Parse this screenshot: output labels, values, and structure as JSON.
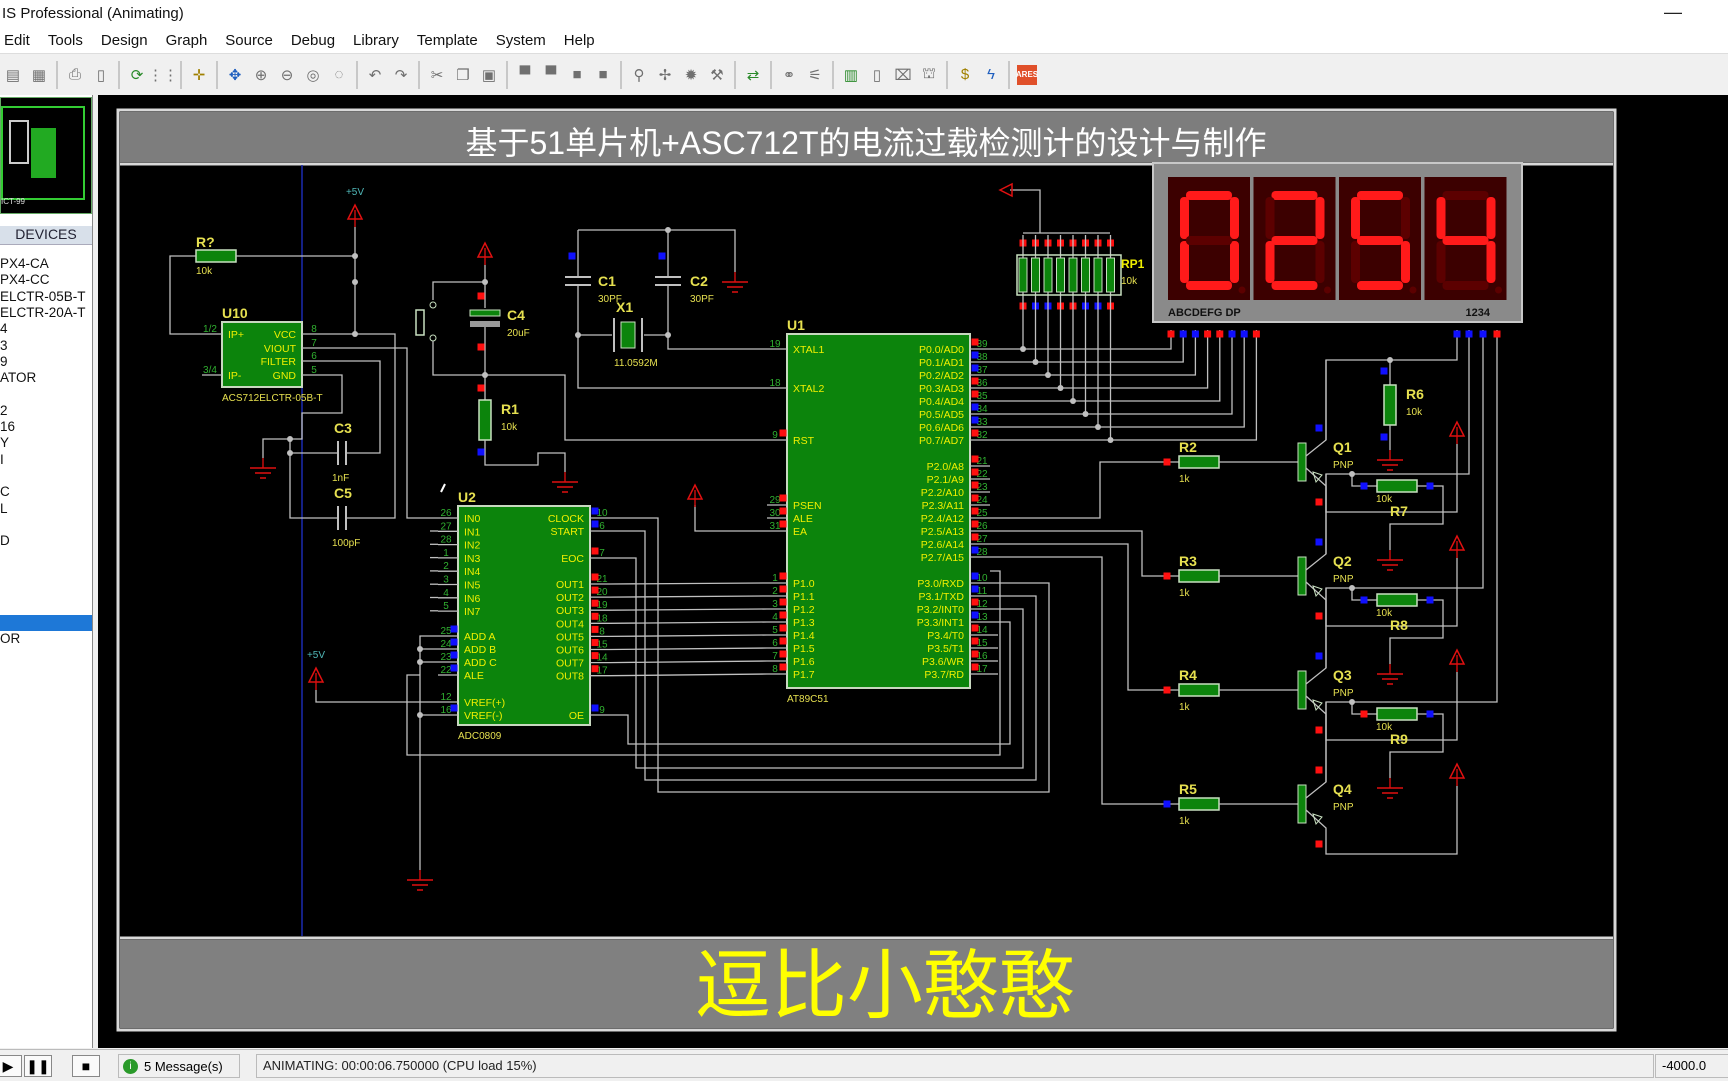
{
  "window": {
    "title": "IS Professional (Animating)",
    "minimize": "—"
  },
  "menu": [
    "Edit",
    "Tools",
    "Design",
    "Graph",
    "Source",
    "Debug",
    "Library",
    "Template",
    "System",
    "Help"
  ],
  "toolbar": {
    "icons": [
      "copy-icon",
      "paste-icon",
      "sep",
      "print-icon",
      "page-icon",
      "sep",
      "refresh-icon",
      "grid-icon",
      "sep",
      "origin-icon",
      "sep",
      "pan-icon",
      "zoom-in-icon",
      "zoom-out-icon",
      "zoom-all-icon",
      "zoom-area-icon",
      "sep",
      "undo-icon",
      "redo-icon",
      "sep",
      "cut-icon",
      "copy-clip-icon",
      "paste-clip-icon",
      "sep",
      "block-copy-icon",
      "block-move-icon",
      "block-rotate-icon",
      "block-delete-icon",
      "sep",
      "pick-device-icon",
      "make-device-icon",
      "package-icon",
      "decompose-icon",
      "sep",
      "wire-autorouter-icon",
      "sep",
      "search-icon",
      "property-tool-icon",
      "sep",
      "netlist-icon",
      "new-sheet-icon",
      "remove-sheet-icon",
      "child-sheet-icon",
      "sep",
      "bill-of-materials-icon",
      "electrical-check-icon",
      "sep",
      "ares-icon"
    ]
  },
  "left_panel": {
    "header": "DEVICES",
    "items": [
      "PX4-CA",
      "PX4-CC",
      "ELCTR-05B-T",
      "ELCTR-20A-T",
      "4",
      "3",
      "9",
      "ATOR",
      "",
      "2",
      "16",
      "Y",
      "I",
      "",
      "C",
      "L",
      "",
      "D",
      "",
      "",
      "",
      "",
      "",
      "OR"
    ],
    "selected_index": 22
  },
  "schematic": {
    "title": "基于51单片机+ASC712T的电流过载检测计的设计与制作",
    "footer": "逗比小憨憨",
    "power_label": "+5V",
    "parts": {
      "r_unnamed": {
        "ref": "R?",
        "value": "10k"
      },
      "r1": {
        "ref": "R1",
        "value": "10k"
      },
      "c1": {
        "ref": "C1",
        "value": "30PF"
      },
      "c2": {
        "ref": "C2",
        "value": "30PF"
      },
      "c3": {
        "ref": "C3",
        "value": "1nF"
      },
      "c4": {
        "ref": "C4",
        "value": "20uF"
      },
      "c5": {
        "ref": "C5",
        "value": "100pF"
      },
      "x1": {
        "ref": "X1",
        "value": "11.0592M"
      },
      "rp": {
        "ref": "RP1",
        "value": "10k"
      },
      "r2": {
        "ref": "R2",
        "value": "1k"
      },
      "r3": {
        "ref": "R3",
        "value": "1k"
      },
      "r4": {
        "ref": "R4",
        "value": "1k"
      },
      "r5": {
        "ref": "R5",
        "value": "1k"
      },
      "r6": {
        "ref": "R6",
        "value": "10k"
      },
      "r7": {
        "ref": "R7",
        "value": "10k"
      },
      "r8": {
        "ref": "R8",
        "value": "10k"
      },
      "r9": {
        "ref": "R9",
        "value": "10k"
      },
      "q1": {
        "ref": "Q1",
        "type": "PNP"
      },
      "q2": {
        "ref": "Q2",
        "type": "PNP"
      },
      "q3": {
        "ref": "Q3",
        "type": "PNP"
      },
      "q4": {
        "ref": "Q4",
        "type": "PNP"
      }
    },
    "u10": {
      "ref": "U10",
      "part": "ACS712ELCTR-05B-T",
      "left": [
        {
          "label": "IP+",
          "pin": "1/2"
        },
        {
          "label": "IP-",
          "pin": "3/4"
        }
      ],
      "right": [
        {
          "label": "VCC",
          "pin": "8"
        },
        {
          "label": "VIOUT",
          "pin": "7"
        },
        {
          "label": "FILTER",
          "pin": "6"
        },
        {
          "label": "GND",
          "pin": "5"
        }
      ]
    },
    "u2": {
      "ref": "U2",
      "part": "ADC0809",
      "left": [
        {
          "label": "IN0",
          "pin": "26"
        },
        {
          "label": "IN1",
          "pin": "27"
        },
        {
          "label": "IN2",
          "pin": "28"
        },
        {
          "label": "IN3",
          "pin": "1"
        },
        {
          "label": "IN4",
          "pin": "2"
        },
        {
          "label": "IN5",
          "pin": "3"
        },
        {
          "label": "IN6",
          "pin": "4"
        },
        {
          "label": "IN7",
          "pin": "5"
        },
        {
          "label": "ADD A",
          "pin": "25",
          "state": 0
        },
        {
          "label": "ADD B",
          "pin": "24",
          "state": 0
        },
        {
          "label": "ADD C",
          "pin": "23",
          "state": 0
        },
        {
          "label": "ALE",
          "pin": "22",
          "state": 0
        },
        {
          "label": "VREF(+)",
          "pin": "12"
        },
        {
          "label": "VREF(-)",
          "pin": "16",
          "state": 0
        }
      ],
      "right": [
        {
          "label": "CLOCK",
          "pin": "10",
          "state": 0
        },
        {
          "label": "START",
          "pin": "6",
          "state": 0
        },
        {
          "label": "EOC",
          "pin": "7",
          "state": 1
        },
        {
          "label": "OUT1",
          "pin": "21",
          "state": 1
        },
        {
          "label": "OUT2",
          "pin": "20",
          "state": 1
        },
        {
          "label": "OUT3",
          "pin": "19",
          "state": 1
        },
        {
          "label": "OUT4",
          "pin": "18",
          "state": 1
        },
        {
          "label": "OUT5",
          "pin": "8",
          "state": 1
        },
        {
          "label": "OUT6",
          "pin": "15",
          "state": 1
        },
        {
          "label": "OUT7",
          "pin": "14",
          "state": 1
        },
        {
          "label": "OUT8",
          "pin": "17",
          "state": 1
        },
        {
          "label": "OE",
          "pin": "9",
          "state": 0
        }
      ]
    },
    "u1": {
      "ref": "U1",
      "part": "AT89C51",
      "left": [
        {
          "label": "XTAL1",
          "pin": "19"
        },
        {
          "label": "XTAL2",
          "pin": "18"
        },
        {
          "label": "RST",
          "pin": "9",
          "state": 1
        },
        {
          "label": "PSEN",
          "pin": "29",
          "state": 1
        },
        {
          "label": "ALE",
          "pin": "30",
          "state": 1
        },
        {
          "label": "EA",
          "pin": "31",
          "state": 1
        },
        {
          "label": "P1.0",
          "pin": "1",
          "state": 1
        },
        {
          "label": "P1.1",
          "pin": "2",
          "state": 1
        },
        {
          "label": "P1.2",
          "pin": "3",
          "state": 1
        },
        {
          "label": "P1.3",
          "pin": "4",
          "state": 1
        },
        {
          "label": "P1.4",
          "pin": "5",
          "state": 1
        },
        {
          "label": "P1.5",
          "pin": "6",
          "state": 1
        },
        {
          "label": "P1.6",
          "pin": "7",
          "state": 1
        },
        {
          "label": "P1.7",
          "pin": "8",
          "state": 1
        }
      ],
      "right": [
        {
          "label": "P0.0/AD0",
          "pin": "39",
          "state": 1
        },
        {
          "label": "P0.1/AD1",
          "pin": "38",
          "state": 0
        },
        {
          "label": "P0.2/AD2",
          "pin": "37",
          "state": 0
        },
        {
          "label": "P0.3/AD3",
          "pin": "36",
          "state": 1
        },
        {
          "label": "P0.4/AD4",
          "pin": "35",
          "state": 1
        },
        {
          "label": "P0.5/AD5",
          "pin": "34",
          "state": 0
        },
        {
          "label": "P0.6/AD6",
          "pin": "33",
          "state": 0
        },
        {
          "label": "P0.7/AD7",
          "pin": "32",
          "state": 1
        },
        {
          "label": "P2.0/A8",
          "pin": "21",
          "state": 1
        },
        {
          "label": "P2.1/A9",
          "pin": "22",
          "state": 1
        },
        {
          "label": "P2.2/A10",
          "pin": "23",
          "state": 1
        },
        {
          "label": "P2.3/A11",
          "pin": "24",
          "state": 1
        },
        {
          "label": "P2.4/A12",
          "pin": "25",
          "state": 1
        },
        {
          "label": "P2.5/A13",
          "pin": "26",
          "state": 1
        },
        {
          "label": "P2.6/A14",
          "pin": "27",
          "state": 1
        },
        {
          "label": "P2.7/A15",
          "pin": "28",
          "state": 0
        },
        {
          "label": "P3.0/RXD",
          "pin": "10",
          "state": 0
        },
        {
          "label": "P3.1/TXD",
          "pin": "11",
          "state": 0
        },
        {
          "label": "P3.2/INT0",
          "pin": "12",
          "state": 1
        },
        {
          "label": "P3.3/INT1",
          "pin": "13",
          "state": 0
        },
        {
          "label": "P3.4/T0",
          "pin": "14",
          "state": 1
        },
        {
          "label": "P3.5/T1",
          "pin": "15",
          "state": 1
        },
        {
          "label": "P3.6/WR",
          "pin": "16",
          "state": 1
        },
        {
          "label": "P3.7/RD",
          "pin": "17",
          "state": 1
        }
      ]
    },
    "display": {
      "value": "0254",
      "segment_label": "ABCDEFG  DP",
      "digit_label": "1234",
      "lit_color": "#ff1a1a",
      "unlit_color": "#5c0000"
    },
    "colors": {
      "chip_fill": "#0c840c",
      "wire": "#c0c0c0",
      "logic_high": "#ff1010",
      "logic_low": "#1010ff",
      "power": "#e01010",
      "label": "#e6e050"
    }
  },
  "status": {
    "messages": "5 Message(s)",
    "animation": "ANIMATING: 00:00:06.750000 (CPU load 15%)",
    "coord": "-4000.0"
  }
}
